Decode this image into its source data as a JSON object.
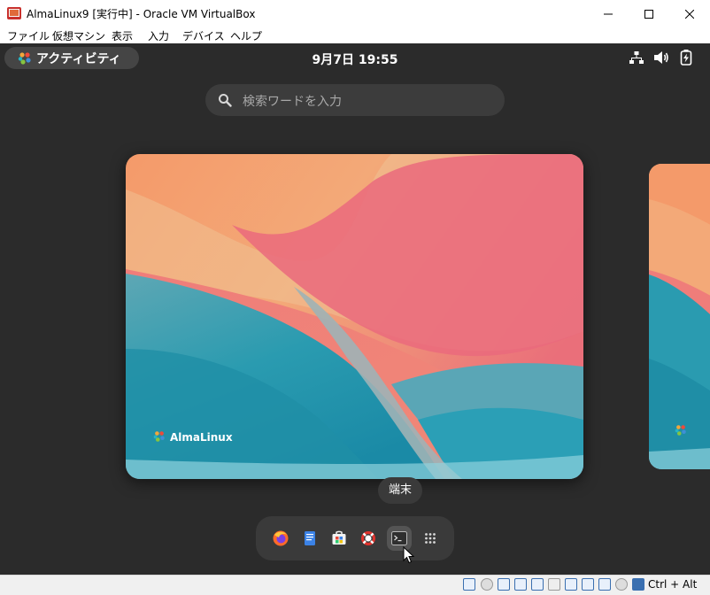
{
  "window": {
    "title": "AlmaLinux9 [実行中] - Oracle VM VirtualBox",
    "minimize_glyph": "─",
    "maximize_glyph": "☐",
    "close_glyph": "✕"
  },
  "menubar": {
    "items": [
      "ファイル",
      "仮想マシン",
      "表示",
      "入力",
      "デバイス",
      "ヘルプ"
    ]
  },
  "top_panel": {
    "activities_label": "アクティビティ",
    "clock": "9月7日  19:55",
    "tray_icons": [
      "network-icon",
      "volume-icon",
      "battery-icon"
    ]
  },
  "overview": {
    "search_placeholder": "検索ワードを入力",
    "workspace_brand": "AlmaLinux",
    "tooltip": "端末"
  },
  "dash": {
    "apps": [
      "firefox-icon",
      "text-editor-icon",
      "software-icon",
      "help-icon",
      "terminal-icon",
      "app-grid-icon"
    ],
    "hovered": "terminal-icon"
  },
  "statusbar": {
    "host_key": "Ctrl + Alt"
  },
  "colors": {
    "guest_bg": "#2b2b2b",
    "panel_pill": "#454545",
    "accent_blue": "#3a6fb0"
  }
}
